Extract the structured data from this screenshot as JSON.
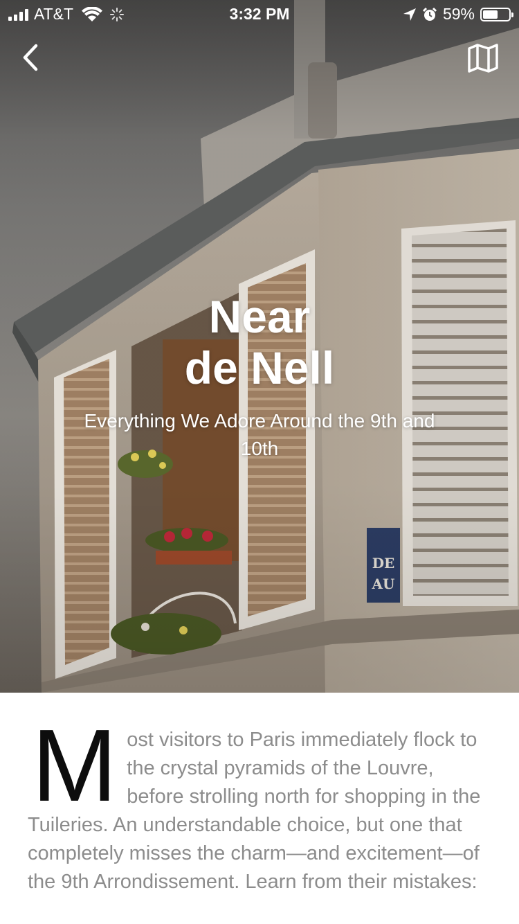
{
  "status_bar": {
    "carrier": "AT&T",
    "time": "3:32 PM",
    "battery_percent": "59%",
    "battery_level": 0.59
  },
  "nav": {
    "back_icon": "chevron-left-icon",
    "map_icon": "map-icon"
  },
  "hero": {
    "title_line1": "Near",
    "title_line2": "de Nell",
    "subtitle": "Everything We Adore Around the 9th and 10th",
    "sign_text_line1": "DE",
    "sign_text_line2": "AU"
  },
  "article": {
    "drop_cap": "M",
    "body": "ost visitors to Paris immediately flock to the crystal pyramids of the Louvre, before strolling north for shopping in the Tuileries. An understandable choice, but one that completely misses the charm—and excitement—of the 9th Arrondissement. Learn from their mistakes:"
  },
  "colors": {
    "body_text": "#8c8c8c",
    "drop_cap": "#0d0d0d",
    "overlay_text": "#ffffff"
  }
}
